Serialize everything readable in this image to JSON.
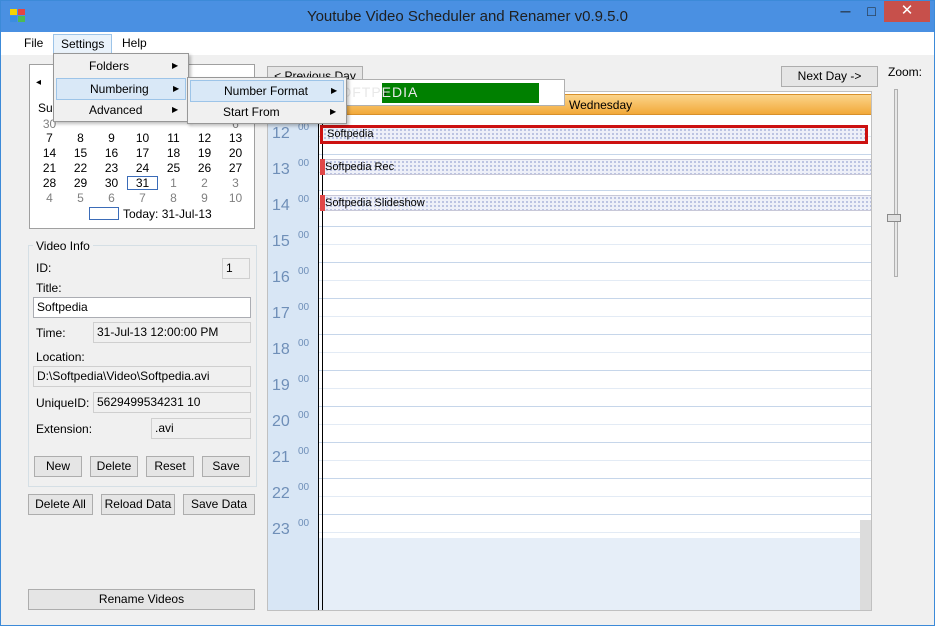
{
  "window": {
    "title": "Youtube Video Scheduler and Renamer v0.9.5.0",
    "minimize": "─",
    "maximize": "□",
    "close": "✕"
  },
  "menubar": {
    "file": "File",
    "settings": "Settings",
    "help": "Help"
  },
  "settings_menu": {
    "folders": "Folders",
    "numbering": "Numbering",
    "advanced": "Advanced"
  },
  "numbering_menu": {
    "number_format": "Number Format",
    "start_from": "Start From"
  },
  "calendar": {
    "prev_glyph": "◂",
    "first_day_partial": "Su",
    "rows": [
      [
        "30",
        "",
        "",
        "",
        "",
        "",
        "6"
      ],
      [
        "7",
        "8",
        "9",
        "10",
        "11",
        "12",
        "13"
      ],
      [
        "14",
        "15",
        "16",
        "17",
        "18",
        "19",
        "20"
      ],
      [
        "21",
        "22",
        "23",
        "24",
        "25",
        "26",
        "27"
      ],
      [
        "28",
        "29",
        "30",
        "31",
        "1",
        "2",
        "3"
      ],
      [
        "4",
        "5",
        "6",
        "7",
        "8",
        "9",
        "10"
      ]
    ],
    "today_label": "Today: 31-Jul-13"
  },
  "video_info": {
    "group_title": "Video Info",
    "id_label": "ID:",
    "id_value": "1",
    "title_label": "Title:",
    "title_value": "Softpedia",
    "time_label": "Time:",
    "time_value": "31-Jul-13 12:00:00 PM",
    "location_label": "Location:",
    "location_value": "D:\\Softpedia\\Video\\Softpedia.avi",
    "uniqueid_label": "UniqueID:",
    "uniqueid_value": "5629499534231 10",
    "extension_label": "Extension:",
    "extension_value": ".avi",
    "new_btn": "New",
    "delete_btn": "Delete",
    "reset_btn": "Reset",
    "save_btn": "Save"
  },
  "bottom_buttons": {
    "delete_all": "Delete All",
    "reload_data": "Reload Data",
    "save_data": "Save Data",
    "rename_videos": "Rename Videos"
  },
  "schedule": {
    "prev_day": "< Previous Day",
    "next_day": "Next Day ->",
    "zoom_label": "Zoom:",
    "day_header": "Wednesday",
    "watermark": "SOFTPEDIA",
    "progress_label": "#",
    "hours": [
      "12",
      "13",
      "14",
      "15",
      "16",
      "17",
      "18",
      "19",
      "20",
      "21",
      "22",
      "23"
    ],
    "minutes": "00",
    "appointments": [
      "Softpedia",
      "Softpedia Rec",
      "Softpedia Slideshow"
    ]
  },
  "colors": {
    "accent": "#4a90e2",
    "close": "#c7504b",
    "day_header": "#f5b84a",
    "selected_border": "#cc1111",
    "progress": "#008000"
  }
}
